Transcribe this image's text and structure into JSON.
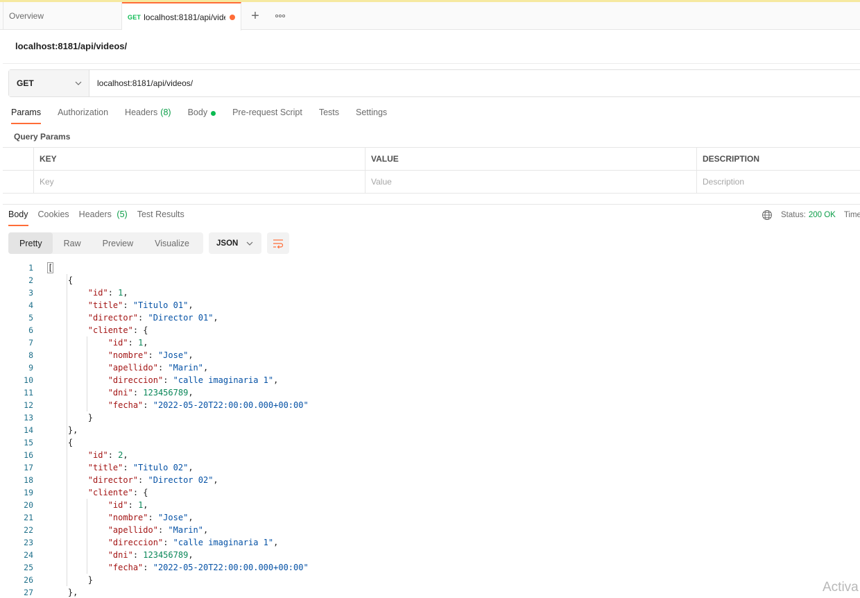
{
  "tabs": {
    "overview_label": "Overview",
    "active_method": "GET",
    "active_url": "localhost:8181/api/vide"
  },
  "request": {
    "name": "localhost:8181/api/videos/",
    "method": "GET",
    "url": "localhost:8181/api/videos/"
  },
  "request_tabs": [
    {
      "label": "Params"
    },
    {
      "label": "Authorization"
    },
    {
      "label": "Headers",
      "count": "(8)"
    },
    {
      "label": "Body"
    },
    {
      "label": "Pre-request Script"
    },
    {
      "label": "Tests"
    },
    {
      "label": "Settings"
    }
  ],
  "query_params": {
    "title": "Query Params",
    "headers": [
      "KEY",
      "VALUE",
      "DESCRIPTION"
    ],
    "placeholders": [
      "Key",
      "Value",
      "Description"
    ]
  },
  "response_tabs": [
    {
      "label": "Body"
    },
    {
      "label": "Cookies"
    },
    {
      "label": "Headers",
      "count": "(5)"
    },
    {
      "label": "Test Results"
    }
  ],
  "status": {
    "label": "Status:",
    "value": "200 OK",
    "time_label": "Time"
  },
  "format": {
    "buttons": [
      "Pretty",
      "Raw",
      "Preview",
      "Visualize"
    ],
    "type": "JSON"
  },
  "code_lines": [
    "[",
    "    {",
    "        \"id\": 1,",
    "        \"title\": \"Titulo 01\",",
    "        \"director\": \"Director 01\",",
    "        \"cliente\": {",
    "            \"id\": 1,",
    "            \"nombre\": \"Jose\",",
    "            \"apellido\": \"Marin\",",
    "            \"direccion\": \"calle imaginaria 1\",",
    "            \"dni\": 123456789,",
    "            \"fecha\": \"2022-05-20T22:00:00.000+00:00\"",
    "        }",
    "    },",
    "    {",
    "        \"id\": 2,",
    "        \"title\": \"Titulo 02\",",
    "        \"director\": \"Director 02\",",
    "        \"cliente\": {",
    "            \"id\": 1,",
    "            \"nombre\": \"Jose\",",
    "            \"apellido\": \"Marin\",",
    "            \"direccion\": \"calle imaginaria 1\",",
    "            \"dni\": 123456789,",
    "            \"fecha\": \"2022-05-20T22:00:00.000+00:00\"",
    "        }",
    "    },"
  ],
  "watermark": "Activa",
  "colors": {
    "accent": "#ff6c37",
    "method_get": "#0cbb52",
    "status_ok": "#0a9d47",
    "json_key": "#a31515",
    "json_string": "#0451a5",
    "json_number": "#098658"
  }
}
